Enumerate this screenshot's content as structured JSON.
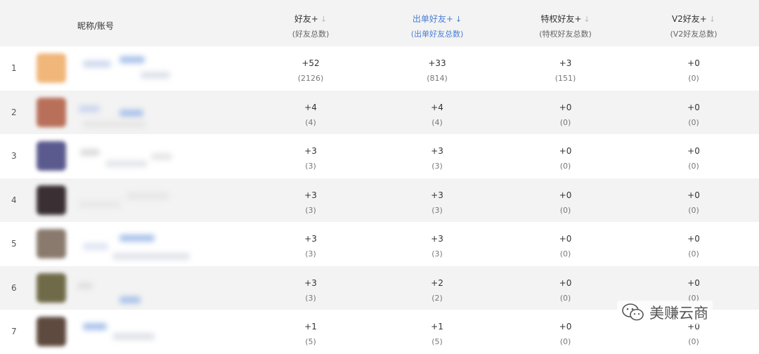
{
  "header": {
    "nick_label": "昵称/账号",
    "columns": [
      {
        "label": "好友+",
        "sub": "(好友总数)",
        "sort": "↓",
        "active": false
      },
      {
        "label": "出单好友+",
        "sub": "(出单好友总数)",
        "sort": "↓",
        "active": true
      },
      {
        "label": "特权好友+",
        "sub": "(特权好友总数)",
        "sort": "↓",
        "active": false
      },
      {
        "label": "V2好友+",
        "sub": "(V2好友总数)",
        "sort": "↓",
        "active": false
      }
    ]
  },
  "rows": [
    {
      "rank": "1",
      "avatar_color": "#f0b67a",
      "c1": {
        "top": "+52",
        "bot": "(2126)"
      },
      "c2": {
        "top": "+33",
        "bot": "(814)"
      },
      "c3": {
        "top": "+3",
        "bot": "(151)"
      },
      "c4": {
        "top": "+0",
        "bot": "(0)"
      }
    },
    {
      "rank": "2",
      "avatar_color": "#b8705a",
      "c1": {
        "top": "+4",
        "bot": "(4)"
      },
      "c2": {
        "top": "+4",
        "bot": "(4)"
      },
      "c3": {
        "top": "+0",
        "bot": "(0)"
      },
      "c4": {
        "top": "+0",
        "bot": "(0)"
      }
    },
    {
      "rank": "3",
      "avatar_color": "#5b5a8e",
      "c1": {
        "top": "+3",
        "bot": "(3)"
      },
      "c2": {
        "top": "+3",
        "bot": "(3)"
      },
      "c3": {
        "top": "+0",
        "bot": "(0)"
      },
      "c4": {
        "top": "+0",
        "bot": "(0)"
      }
    },
    {
      "rank": "4",
      "avatar_color": "#3a2f33",
      "c1": {
        "top": "+3",
        "bot": "(3)"
      },
      "c2": {
        "top": "+3",
        "bot": "(3)"
      },
      "c3": {
        "top": "+0",
        "bot": "(0)"
      },
      "c4": {
        "top": "+0",
        "bot": "(0)"
      }
    },
    {
      "rank": "5",
      "avatar_color": "#8a7a6e",
      "c1": {
        "top": "+3",
        "bot": "(3)"
      },
      "c2": {
        "top": "+3",
        "bot": "(3)"
      },
      "c3": {
        "top": "+0",
        "bot": "(0)"
      },
      "c4": {
        "top": "+0",
        "bot": "(0)"
      }
    },
    {
      "rank": "6",
      "avatar_color": "#6f6a48",
      "c1": {
        "top": "+3",
        "bot": "(3)"
      },
      "c2": {
        "top": "+2",
        "bot": "(2)"
      },
      "c3": {
        "top": "+0",
        "bot": "(0)"
      },
      "c4": {
        "top": "+0",
        "bot": "(0)"
      }
    },
    {
      "rank": "7",
      "avatar_color": "#5e4a3e",
      "c1": {
        "top": "+1",
        "bot": "(5)"
      },
      "c2": {
        "top": "+1",
        "bot": "(5)"
      },
      "c3": {
        "top": "+0",
        "bot": "(0)"
      },
      "c4": {
        "top": "+0",
        "bot": "(0)"
      }
    }
  ],
  "watermark": {
    "text": "美赚云商",
    "icon": "wechat-icon"
  }
}
